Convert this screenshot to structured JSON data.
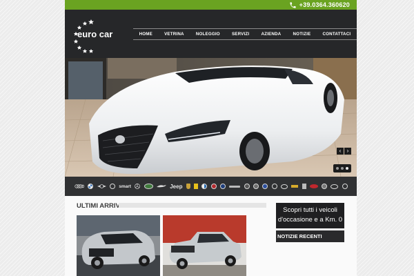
{
  "topbar": {
    "phone": "+39.0364.360620",
    "phone_icon": "phone-icon",
    "color": "#6aa321"
  },
  "header": {
    "logo_text": "euro car",
    "nav": [
      "HOME",
      "VETRINA",
      "NOLEGGIO",
      "SERVIZI",
      "AZIENDA",
      "NOTIZIE",
      "CONTATTACI"
    ]
  },
  "slider": {
    "prev_icon": "chevron-left-icon",
    "next_icon": "chevron-right-icon",
    "prev": "‹",
    "next": "›",
    "slides": 3,
    "active_slide": 1
  },
  "brands": {
    "labels": [
      "smart",
      "Jeep"
    ],
    "icons": [
      "audi-logo-icon",
      "bmw-logo-icon",
      "mini-logo-icon",
      "citroen-logo-icon",
      "smart-logo-icon",
      "mercedes-logo-icon",
      "land-rover-logo-icon",
      "jaguar-logo-icon",
      "jeep-logo-icon",
      "porsche-logo-icon",
      "ferrari-logo-icon",
      "alfa-romeo-logo-icon",
      "fiat-logo-icon",
      "lancia-logo-icon",
      "abarth-logo-icon",
      "maserati-logo-icon",
      "opel-logo-icon",
      "ford-logo-icon",
      "lexus-logo-icon",
      "toyota-logo-icon",
      "chevrolet-logo-icon",
      "peugeot-logo-icon",
      "kia-logo-icon",
      "volvo-logo-icon",
      "hyundai-logo-icon",
      "nissan-logo-icon"
    ]
  },
  "content": {
    "section_title": "ULTIMI ARRIVI",
    "cta": "Scopri tutti i veicoli d'occasione e a Km. 0",
    "news_title": "NOTIZIE RECENTI"
  }
}
